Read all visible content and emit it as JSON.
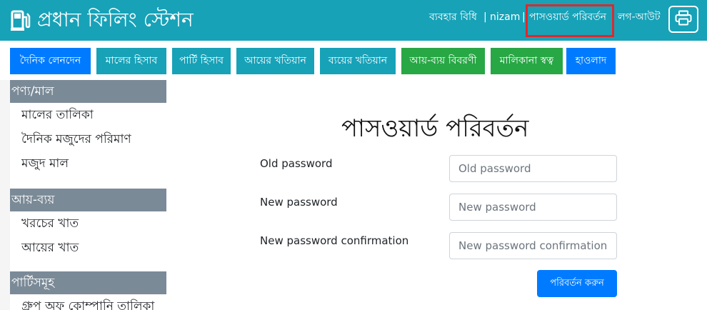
{
  "header": {
    "brand": "প্রধান ফিলিং স্টেশন",
    "usage_policy": "ব্যবহার বিধি",
    "separator": "|",
    "username": "nizam",
    "change_password": "পাসওয়ার্ড পরিবর্তন",
    "logout": "লগ-আউট",
    "icons": {
      "logo": "fuel-pump-icon",
      "print": "printer-icon"
    },
    "colors": {
      "background": "#17a2b8",
      "highlight_border": "#e0282b"
    }
  },
  "nav": {
    "items": [
      {
        "label": "দৈনিক লেনদেন",
        "color": "#007bff"
      },
      {
        "label": "মালের হিসাব",
        "color": "#17a2b8"
      },
      {
        "label": "পার্টি হিসাব",
        "color": "#17a2b8"
      },
      {
        "label": "আয়ের খতিয়ান",
        "color": "#17a2b8"
      },
      {
        "label": "ব্যয়ের খতিয়ান",
        "color": "#17a2b8"
      },
      {
        "label": "আয়-ব্যয় বিবরণী",
        "color": "#28a745"
      },
      {
        "label": "মালিকানা স্বত্ব",
        "color": "#28a745"
      },
      {
        "label": "হাওলাদ",
        "color": "#007bff"
      }
    ]
  },
  "sidebar": {
    "sections": [
      {
        "title": "পণ্য/মাল",
        "items": [
          "মালের তালিকা",
          "দৈনিক মজুদের পরিমাণ",
          "মজুদ মাল"
        ]
      },
      {
        "title": "আয়-ব্যয়",
        "items": [
          "খরচের খাত",
          "আয়ের খাত"
        ]
      },
      {
        "title": "পার্টিসমূহ",
        "items": [
          "গ্রুপ অফ কোম্পানি তালিকা"
        ]
      }
    ]
  },
  "form": {
    "title": "পাসওয়ার্ড পরিবর্তন",
    "fields": [
      {
        "label": "Old password",
        "placeholder": "Old password",
        "value": ""
      },
      {
        "label": "New password",
        "placeholder": "New password",
        "value": ""
      },
      {
        "label": "New password confirmation",
        "placeholder": "New password confirmation",
        "value": ""
      }
    ],
    "submit_label": "পরিবর্তন করুন"
  }
}
